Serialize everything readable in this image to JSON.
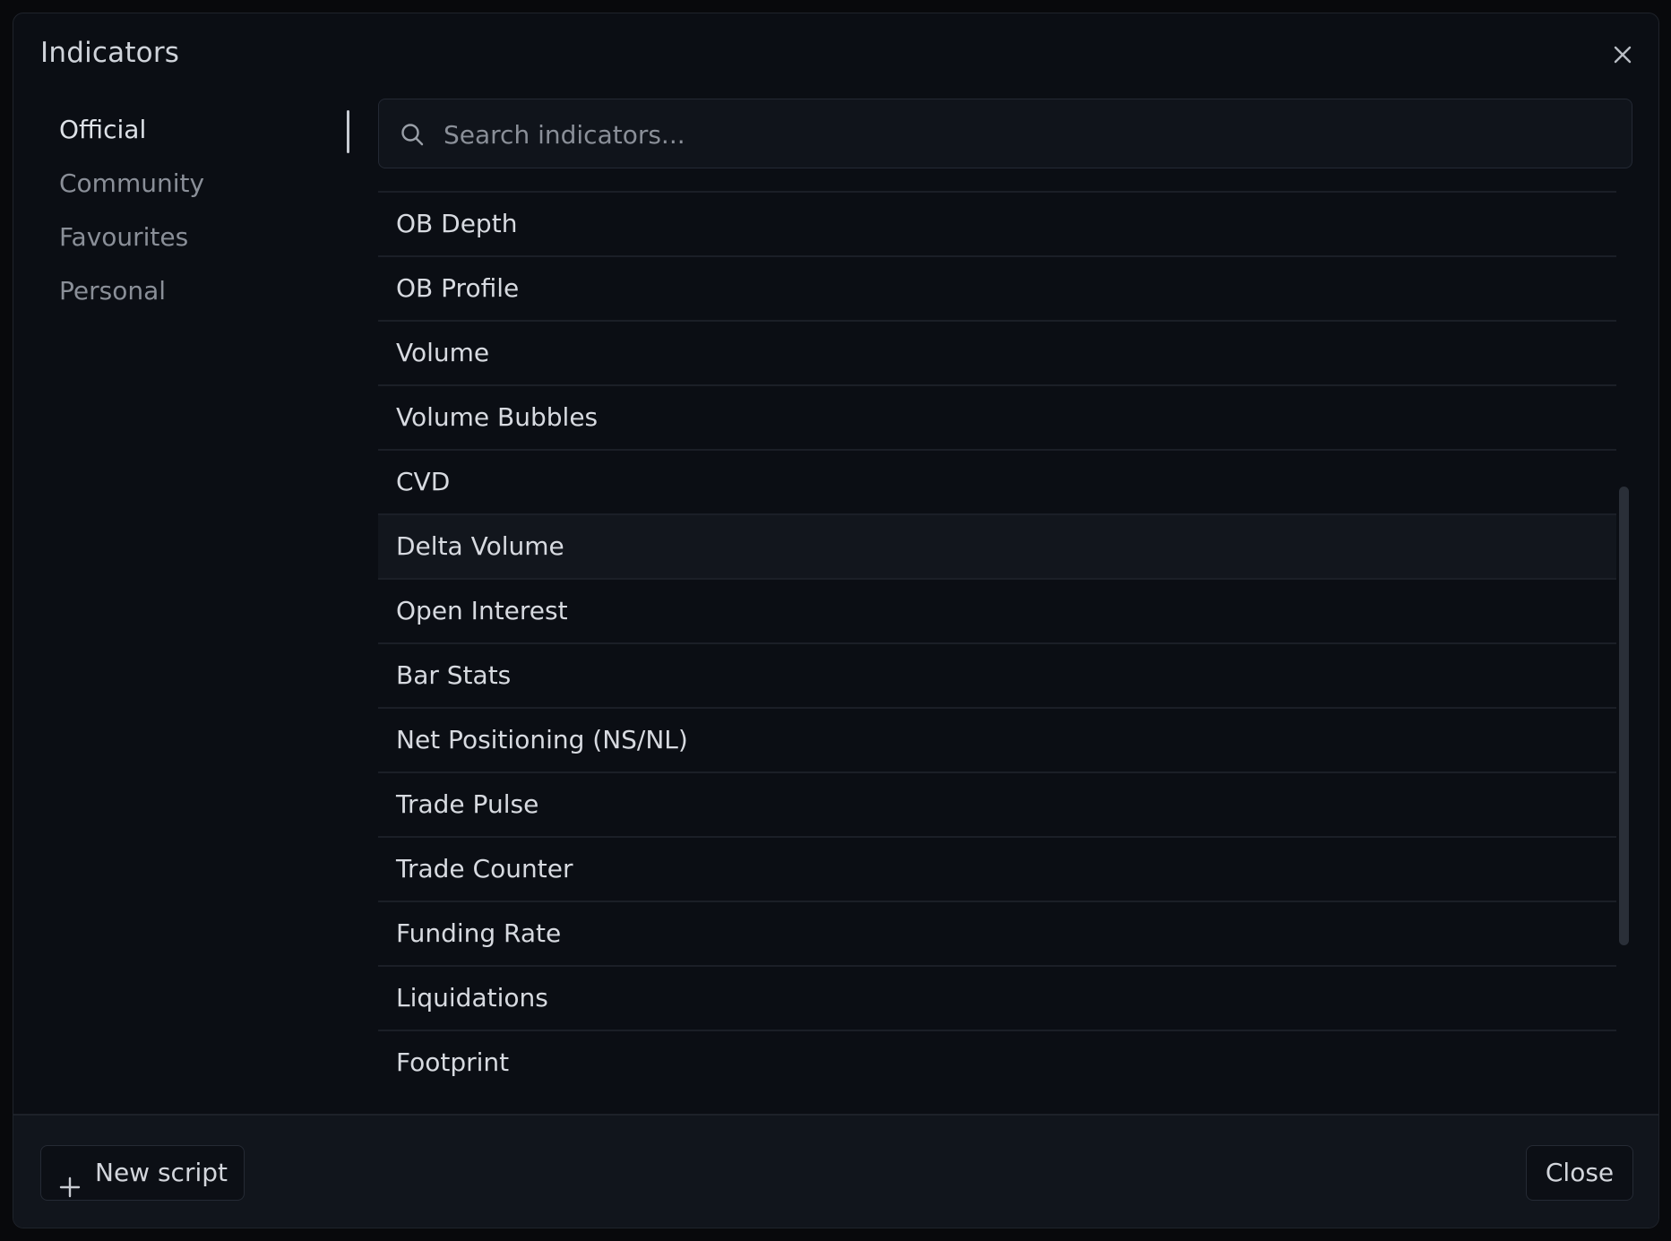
{
  "dialog": {
    "title": "Indicators",
    "close_icon": "close-icon"
  },
  "sidebar": {
    "items": [
      {
        "label": "Official",
        "active": true
      },
      {
        "label": "Community",
        "active": false
      },
      {
        "label": "Favourites",
        "active": false
      },
      {
        "label": "Personal",
        "active": false
      }
    ]
  },
  "search": {
    "placeholder": "Search indicators...",
    "value": "",
    "icon": "search-icon"
  },
  "indicators": {
    "items": [
      "OB Depth",
      "OB Profile",
      "Volume",
      "Volume Bubbles",
      "CVD",
      "Delta Volume",
      "Open Interest",
      "Bar Stats",
      "Net Positioning (NS/NL)",
      "Trade Pulse",
      "Trade Counter",
      "Funding Rate",
      "Liquidations",
      "Footprint"
    ],
    "hovered": "Delta Volume"
  },
  "footer": {
    "new_script_label": "New script",
    "new_script_icon": "plus-icon",
    "close_label": "Close"
  },
  "colors": {
    "background": "#0b0e14",
    "footer": "#11151c",
    "text": "#d7dae0",
    "muted_text": "#8a8f98",
    "border": "#1b1f27"
  }
}
